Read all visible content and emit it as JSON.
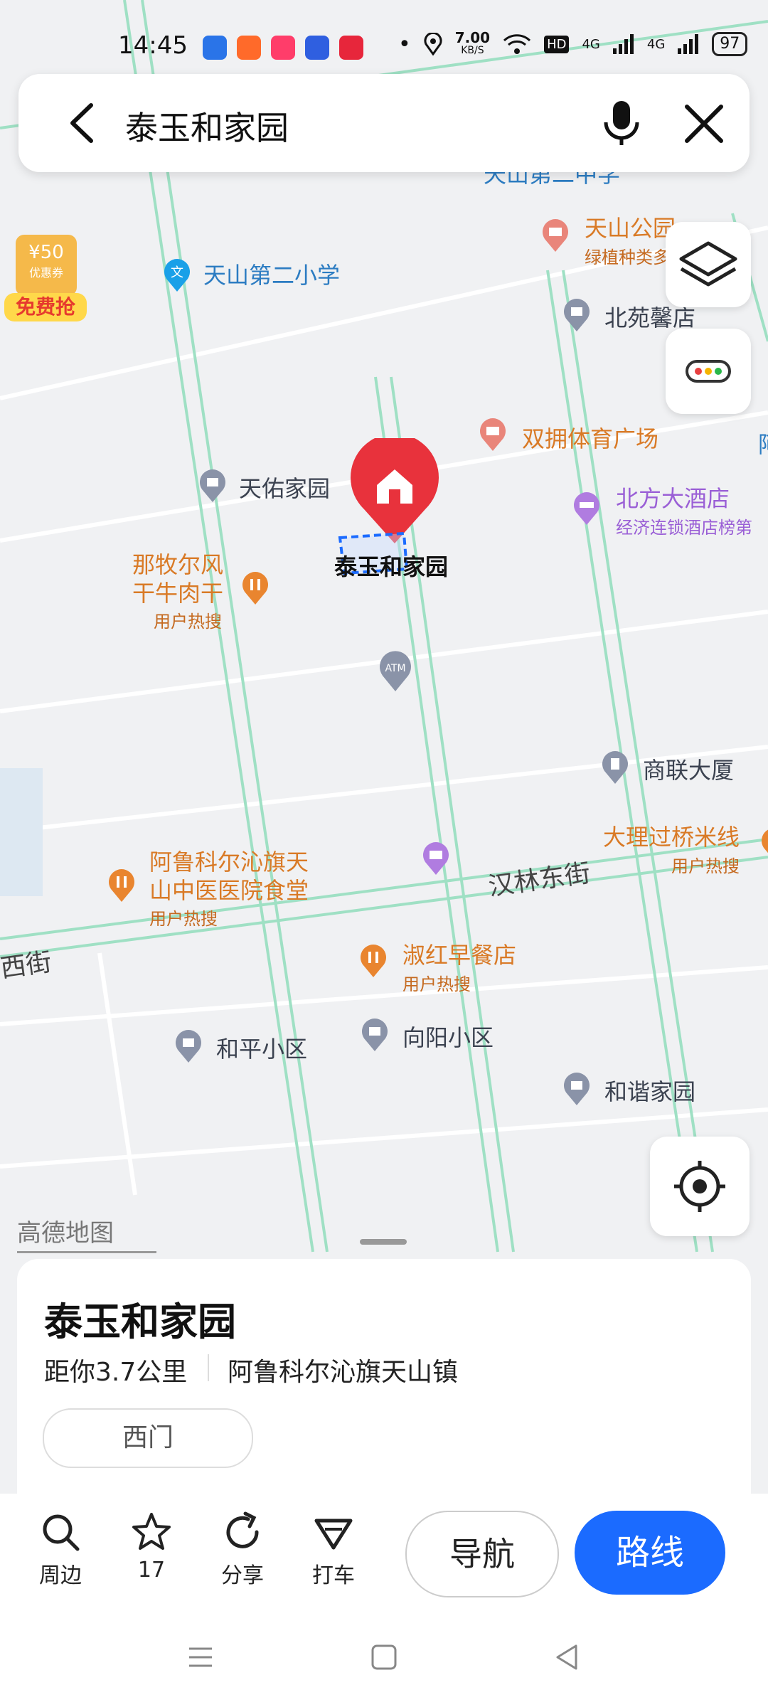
{
  "status_bar": {
    "time": "14:45",
    "network_speed": "7.00",
    "network_unit": "KB/S",
    "hd_label": "HD",
    "net1": "4G",
    "net2": "4G",
    "battery": "97"
  },
  "search": {
    "query": "泰玉和家园"
  },
  "promo": {
    "amount": "¥50",
    "label": "优惠券",
    "caption": "免费抢"
  },
  "map": {
    "scale_label": "高德地图",
    "partial_top_label": "天山第二中学",
    "partial_right_label": "阿",
    "pois": [
      {
        "name": "天山公园",
        "sub": "绿植种类多"
      },
      {
        "name": "天山第二小学"
      },
      {
        "name": "北苑馨店"
      },
      {
        "name": "双拥体育广场"
      },
      {
        "name": "天佑家园"
      },
      {
        "name": "北方大酒店",
        "sub": "经济连锁酒店榜第"
      },
      {
        "name": "泰玉和家园"
      },
      {
        "name": "那牧尔风干牛肉干",
        "sub": "用户热搜"
      },
      {
        "name": "ATM"
      },
      {
        "name": "商联大厦"
      },
      {
        "name": "大理过桥米线",
        "sub": "用户热搜"
      },
      {
        "name": "阿鲁科尔沁旗天山中医医院食堂",
        "sub": "用户热搜"
      },
      {
        "name": "淑红早餐店",
        "sub": "用户热搜"
      },
      {
        "name": "和平小区"
      },
      {
        "name": "向阳小区"
      },
      {
        "name": "和谐家园"
      }
    ],
    "street_labels": [
      "汉林东街",
      "西街"
    ],
    "poi_name_lines": {
      "naomuer_1": "那牧尔风",
      "naomuer_2": "干牛肉干",
      "hospital_1": "阿鲁科尔沁旗天",
      "hospital_2": "山中医医院食堂"
    }
  },
  "place_card": {
    "title": "泰玉和家园",
    "distance": "距你3.7公里",
    "address": "阿鲁科尔沁旗天山镇",
    "entrance_tag": "西门"
  },
  "actions": {
    "nearby": "周边",
    "favorite_count": "17",
    "share": "分享",
    "taxi": "打车",
    "navigate": "导航",
    "route": "路线"
  },
  "colors": {
    "accent": "#1b6bff",
    "marker_red": "#e8323c",
    "poi_orange": "#e9852f",
    "poi_gray": "#8a93a8",
    "road_green": "#9fe0c4"
  }
}
